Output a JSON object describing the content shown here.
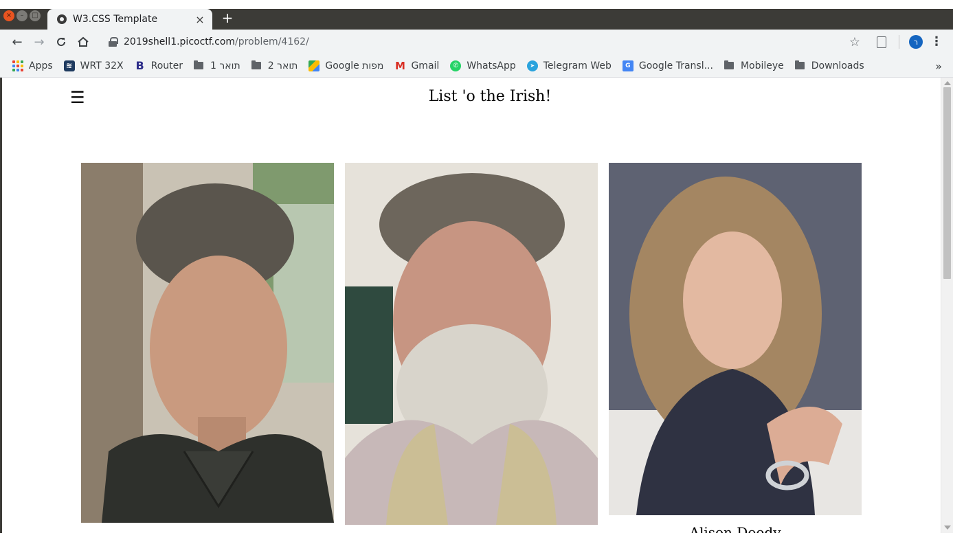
{
  "browser": {
    "tab_title": "W3.CSS Template",
    "tab_close": "×",
    "new_tab": "+",
    "url_host": "2019shell1.picoctf.com",
    "url_path": "/problem/4162/",
    "profile_initial": "ר"
  },
  "bookmarks": [
    {
      "label": "Apps",
      "icon": "apps-grid-icon"
    },
    {
      "label": "WRT 32X",
      "icon": "wifi-router-icon"
    },
    {
      "label": "Router",
      "icon": "router-logo-icon"
    },
    {
      "label": "תואר 1",
      "icon": "folder-icon"
    },
    {
      "label": "תואר 2",
      "icon": "folder-icon"
    },
    {
      "label": "Google מפות",
      "icon": "google-maps-icon"
    },
    {
      "label": "Gmail",
      "icon": "gmail-icon"
    },
    {
      "label": "WhatsApp",
      "icon": "whatsapp-icon"
    },
    {
      "label": "Telegram Web",
      "icon": "telegram-icon"
    },
    {
      "label": "Google Transl...",
      "icon": "google-translate-icon"
    },
    {
      "label": "Mobileye",
      "icon": "folder-icon"
    },
    {
      "label": "Downloads",
      "icon": "folder-icon"
    }
  ],
  "bookmarks_more": "»",
  "page": {
    "menu_glyph": "☰",
    "title": "List 'o the Irish!",
    "cards": [
      {
        "name": "",
        "photo": "portrait-man-dark-shirt"
      },
      {
        "name": "",
        "photo": "portrait-bearded-man"
      },
      {
        "name": "Alison Doody",
        "photo": "portrait-woman-blonde"
      }
    ]
  },
  "colors": {
    "tabstrip": "#3c3b37",
    "toolbar": "#f1f3f4",
    "accent_close": "#e95420",
    "profile": "#1565c0"
  }
}
